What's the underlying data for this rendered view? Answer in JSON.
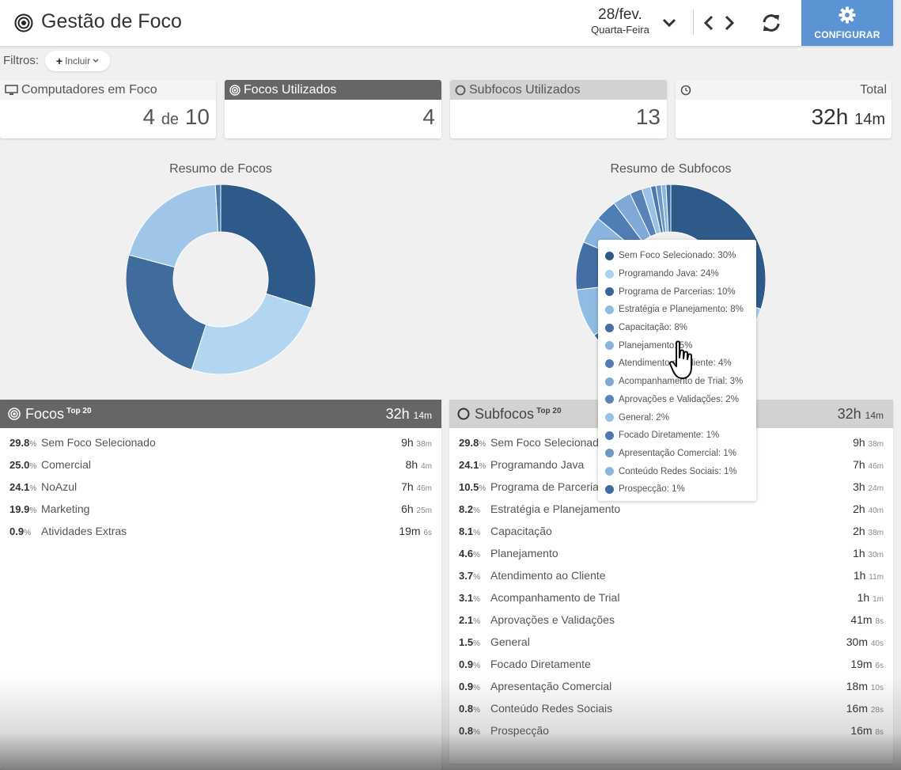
{
  "header": {
    "title": "Gestão de Foco",
    "date_main": "28/fev.",
    "date_weekday": "Quarta-Feira",
    "config_label": "CONFIGURAR",
    "accent_color": "#5b93d3"
  },
  "filters": {
    "label": "Filtros:",
    "add_label": "Incluir"
  },
  "stats": {
    "computers": {
      "label": "Computadores em Foco",
      "value": "4",
      "of": "de",
      "total": "10"
    },
    "focos": {
      "label": "Focos Utilizados",
      "value": "4"
    },
    "subfocos": {
      "label": "Subfocos Utilizados",
      "value": "13"
    },
    "total": {
      "label": "Total",
      "hours": "32h",
      "minutes": "14m"
    }
  },
  "charts": {
    "focos_title": "Resumo de Focos",
    "subfocos_title": "Resumo de Subfocos"
  },
  "chart_data": [
    {
      "type": "pie",
      "title": "Resumo de Focos",
      "categories": [
        "Sem Foco Selecionado",
        "Comercial",
        "NoAzul",
        "Marketing",
        "Atividades Extras"
      ],
      "values": [
        29.8,
        25.0,
        24.1,
        19.9,
        0.9
      ],
      "colors": [
        "#2e5a89",
        "#b3d6f0",
        "#3f6b9d",
        "#9fc6e8",
        "#4a7bb0"
      ]
    },
    {
      "type": "pie",
      "title": "Resumo de Subfocos",
      "categories": [
        "Sem Foco Selecionado",
        "Programando Java",
        "Programa de Parcerias",
        "Estratégia e Planejamento",
        "Capacitação",
        "Planejamento",
        "Atendimento ao Cliente",
        "Acompanhamento de Trial",
        "Aprovações e Validações",
        "General",
        "Focado Diretamente",
        "Apresentação Comercial",
        "Conteúdo Redes Sociais",
        "Prospecção"
      ],
      "values": [
        29.8,
        24.1,
        10.5,
        8.2,
        8.1,
        4.6,
        3.7,
        3.1,
        2.1,
        1.5,
        0.9,
        0.9,
        0.8,
        0.8
      ],
      "colors": [
        "#2e5a89",
        "#a9d1f0",
        "#3a659b",
        "#8fbce3",
        "#446fa5",
        "#88b4de",
        "#4f7db4",
        "#7fa9d6",
        "#5883b8",
        "#9ac2e6",
        "#4c78ad",
        "#6c98c9",
        "#8bb7df",
        "#3d6aa0"
      ]
    }
  ],
  "focos_table": {
    "title": "Focos",
    "badge": "Top 20",
    "total_h": "32h",
    "total_m": "14m",
    "rows": [
      {
        "pct": "29.8",
        "name": "Sem Foco Selecionado",
        "h": "9h",
        "m": "38m"
      },
      {
        "pct": "25.0",
        "name": "Comercial",
        "h": "8h",
        "m": "4m"
      },
      {
        "pct": "24.1",
        "name": "NoAzul",
        "h": "7h",
        "m": "46m"
      },
      {
        "pct": "19.9",
        "name": "Marketing",
        "h": "6h",
        "m": "25m"
      },
      {
        "pct": "0.9",
        "name": "Atividades Extras",
        "h": "19m",
        "m": "6s"
      }
    ]
  },
  "subfocos_table": {
    "title": "Subfocos",
    "badge": "Top 20",
    "total_h": "32h",
    "total_m": "14m",
    "rows": [
      {
        "pct": "29.8",
        "name": "Sem Foco Selecionado",
        "h": "9h",
        "m": "38m"
      },
      {
        "pct": "24.1",
        "name": "Programando Java",
        "h": "7h",
        "m": "46m"
      },
      {
        "pct": "10.5",
        "name": "Programa de Parcerias",
        "h": "3h",
        "m": "24m"
      },
      {
        "pct": "8.2",
        "name": "Estratégia e Planejamento",
        "h": "2h",
        "m": "40m"
      },
      {
        "pct": "8.1",
        "name": "Capacitação",
        "h": "2h",
        "m": "38m"
      },
      {
        "pct": "4.6",
        "name": "Planejamento",
        "h": "1h",
        "m": "30m"
      },
      {
        "pct": "3.7",
        "name": "Atendimento ao Cliente",
        "h": "1h",
        "m": "11m"
      },
      {
        "pct": "3.1",
        "name": "Acompanhamento de Trial",
        "h": "1h",
        "m": "1m"
      },
      {
        "pct": "2.1",
        "name": "Aprovações e Validações",
        "h": "41m",
        "m": "8s"
      },
      {
        "pct": "1.5",
        "name": "General",
        "h": "30m",
        "m": "40s"
      },
      {
        "pct": "0.9",
        "name": "Focado Diretamente",
        "h": "19m",
        "m": "6s"
      },
      {
        "pct": "0.9",
        "name": "Apresentação Comercial",
        "h": "18m",
        "m": "10s"
      },
      {
        "pct": "0.8",
        "name": "Conteúdo Redes Sociais",
        "h": "16m",
        "m": "28s"
      },
      {
        "pct": "0.8",
        "name": "Prospecção",
        "h": "16m",
        "m": "8s"
      }
    ]
  },
  "tooltip": {
    "items": [
      {
        "label": "Sem Foco Selecionado: 30%",
        "color": "#2e5a89"
      },
      {
        "label": "Programando Java: 24%",
        "color": "#a9d1f0"
      },
      {
        "label": "Programa de Parcerias: 10%",
        "color": "#3a659b"
      },
      {
        "label": "Estratégia e Planejamento: 8%",
        "color": "#8fbce3"
      },
      {
        "label": "Capacitação: 8%",
        "color": "#446fa5"
      },
      {
        "label": "Planejamento: 5%",
        "color": "#88b4de"
      },
      {
        "label": "Atendimento ao Cliente: 4%",
        "color": "#4f7db4"
      },
      {
        "label": "Acompanhamento de Trial: 3%",
        "color": "#7fa9d6"
      },
      {
        "label": "Aprovações e Validações: 2%",
        "color": "#5883b8"
      },
      {
        "label": "General: 2%",
        "color": "#9ac2e6"
      },
      {
        "label": "Focado Diretamente: 1%",
        "color": "#4c78ad"
      },
      {
        "label": "Apresentação Comercial: 1%",
        "color": "#6c98c9"
      },
      {
        "label": "Conteúdo Redes Sociais: 1%",
        "color": "#8bb7df"
      },
      {
        "label": "Prospecção: 1%",
        "color": "#3d6aa0"
      }
    ]
  }
}
